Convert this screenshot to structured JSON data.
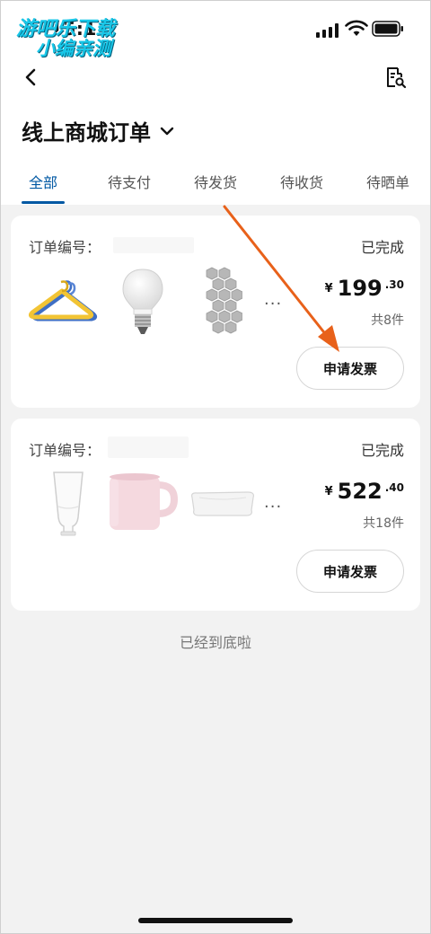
{
  "status_bar": {
    "time": "15:11"
  },
  "watermark": {
    "line1": "游吧乐下载",
    "line2": "小编亲测"
  },
  "header": {
    "title": "线上商城订单"
  },
  "tabs": [
    {
      "label": "全部",
      "active": true
    },
    {
      "label": "待支付",
      "active": false
    },
    {
      "label": "待发货",
      "active": false
    },
    {
      "label": "待收货",
      "active": false
    },
    {
      "label": "待晒单",
      "active": false
    }
  ],
  "orders": [
    {
      "order_no_label": "订单编号：",
      "status": "已完成",
      "price_currency": "¥",
      "price_int": "199",
      "price_dec": ".30",
      "quantity": "共8件",
      "more": "···",
      "invoice_button": "申请发票",
      "items": [
        "hanger-icon",
        "light-bulb-icon",
        "hexagon-tiles-icon"
      ]
    },
    {
      "order_no_label": "订单编号：",
      "status": "已完成",
      "price_currency": "¥",
      "price_int": "522",
      "price_dec": ".40",
      "quantity": "共18件",
      "more": "···",
      "invoice_button": "申请发票",
      "items": [
        "glass-icon",
        "mug-icon",
        "pillow-icon"
      ]
    }
  ],
  "footer": {
    "end_text": "已经到底啦"
  },
  "colors": {
    "accent": "#0058a3",
    "arrow": "#e8611a",
    "background": "#f2f2f2"
  }
}
